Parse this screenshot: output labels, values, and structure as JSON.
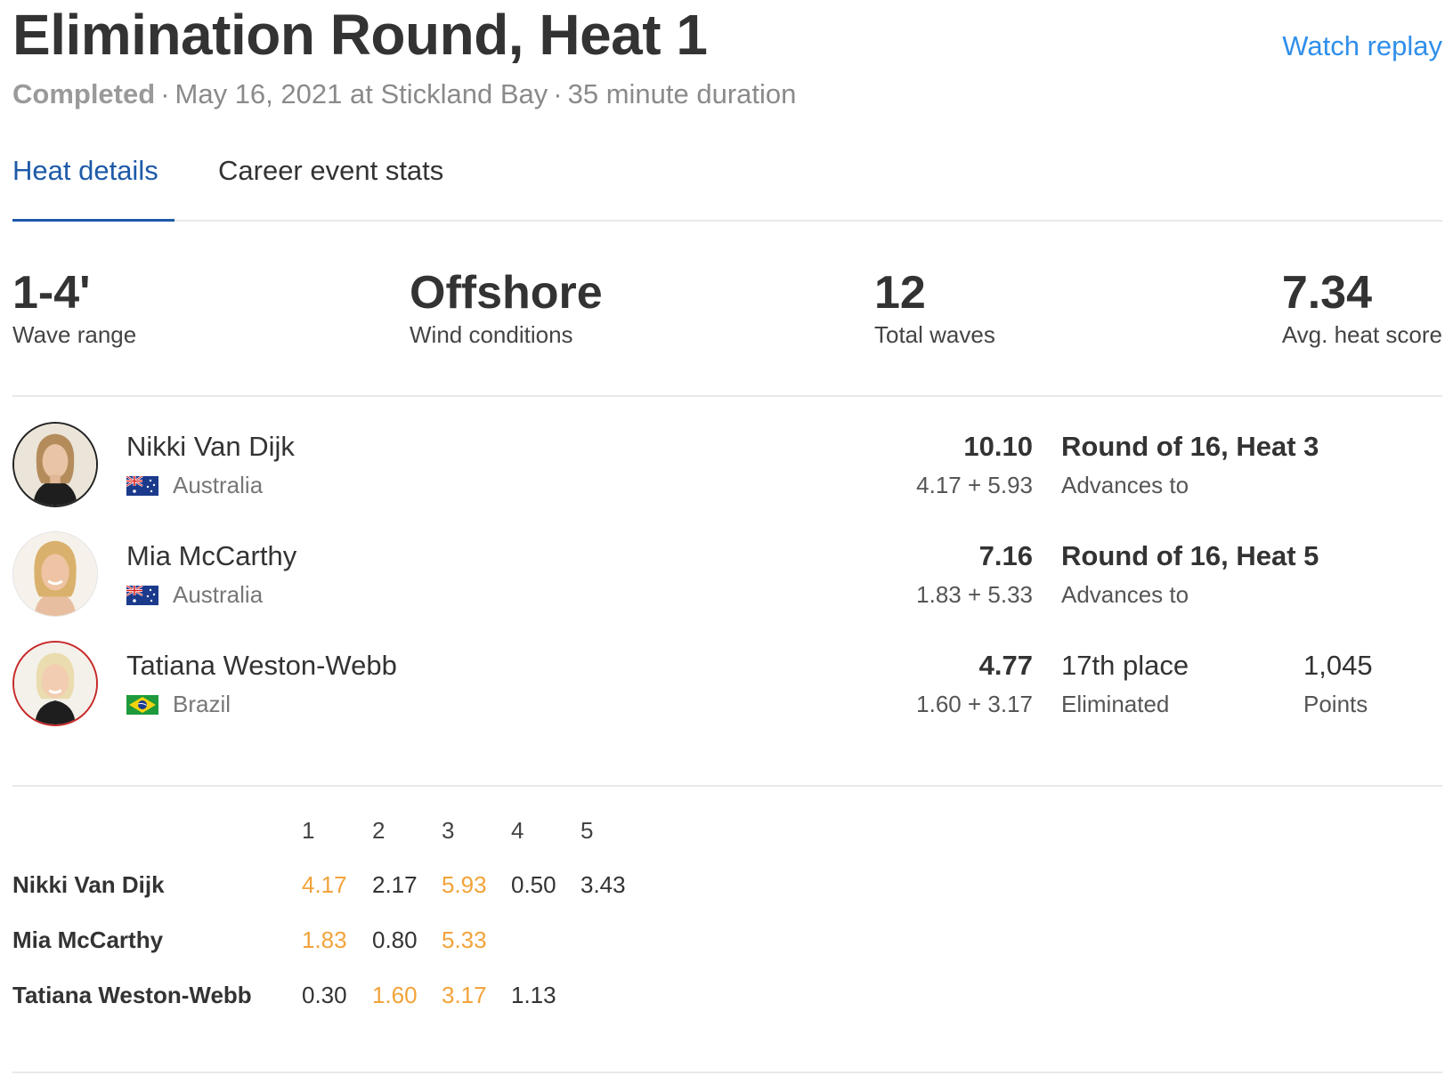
{
  "header": {
    "title": "Elimination Round, Heat 1",
    "watch_replay": "Watch replay",
    "status": "Completed",
    "separator": "·",
    "date_location": "May 16, 2021 at Stickland Bay",
    "duration": "35 minute duration"
  },
  "tabs": [
    {
      "label": "Heat details",
      "active": true
    },
    {
      "label": "Career event stats",
      "active": false
    }
  ],
  "stats": [
    {
      "value": "1-4'",
      "label": "Wave range"
    },
    {
      "value": "Offshore",
      "label": "Wind conditions"
    },
    {
      "value": "12",
      "label": "Total waves"
    },
    {
      "value": "7.34",
      "label": "Avg. heat score"
    }
  ],
  "athletes": [
    {
      "name": "Nikki Van Dijk",
      "country": "Australia",
      "flag": "australia-flag-icon",
      "total": "10.10",
      "parts": "4.17 + 5.93",
      "result": "Round of 16, Heat 3",
      "result_sub": "Advances to"
    },
    {
      "name": "Mia McCarthy",
      "country": "Australia",
      "flag": "australia-flag-icon",
      "total": "7.16",
      "parts": "1.83 + 5.33",
      "result": "Round of 16, Heat 5",
      "result_sub": "Advances to"
    },
    {
      "name": "Tatiana Weston-Webb",
      "country": "Brazil",
      "flag": "brazil-flag-icon",
      "total": "4.77",
      "parts": "1.60 + 3.17",
      "result": "17th place",
      "result_sub": "Eliminated",
      "points": "1,045",
      "points_label": "Points"
    }
  ],
  "wave_table": {
    "columns": [
      "1",
      "2",
      "3",
      "4",
      "5"
    ],
    "highlight_color": "#f2a33a",
    "rows": [
      {
        "name": "Nikki Van Dijk",
        "scores": [
          "4.17",
          "2.17",
          "5.93",
          "0.50",
          "3.43"
        ],
        "highlight": [
          true,
          false,
          true,
          false,
          false
        ]
      },
      {
        "name": "Mia McCarthy",
        "scores": [
          "1.83",
          "0.80",
          "5.33"
        ],
        "highlight": [
          true,
          false,
          true
        ]
      },
      {
        "name": "Tatiana Weston-Webb",
        "scores": [
          "0.30",
          "1.60",
          "3.17",
          "1.13"
        ],
        "highlight": [
          false,
          true,
          true,
          false
        ]
      }
    ]
  },
  "colors": {
    "link": "#2f8fea",
    "tab_active": "#1d5aa8",
    "text": "#333333",
    "muted": "#8a8a8a"
  }
}
